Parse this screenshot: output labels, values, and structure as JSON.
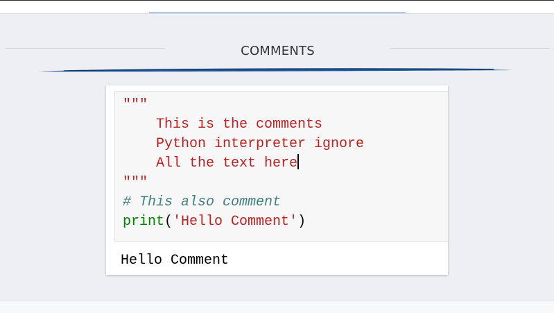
{
  "slide": {
    "title": "COMMENTS"
  },
  "code": {
    "lines": [
      {
        "text": "\"\"\"",
        "type": "docstring"
      },
      {
        "text": "    This is the comments",
        "type": "docstring"
      },
      {
        "text": "    Python interpreter ignore",
        "type": "docstring"
      },
      {
        "text": "    All the text here",
        "type": "docstring"
      },
      {
        "text": "\"\"\"",
        "type": "docstring"
      },
      {
        "text": "# This also comment",
        "type": "comment"
      }
    ],
    "print_keyword": "print",
    "print_open": "(",
    "print_string": "'Hello Comment'",
    "print_close": ")"
  },
  "output": {
    "text": "Hello Comment"
  },
  "colors": {
    "docstring": "#ba2121",
    "comment": "#408080",
    "keyword": "#008000",
    "slide_background": "#edeff2",
    "accent": "#1f5596"
  }
}
